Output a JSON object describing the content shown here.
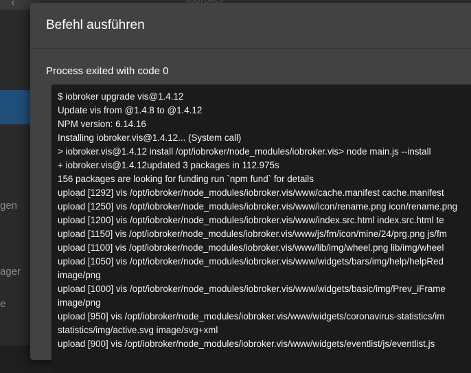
{
  "background": {
    "app_title": "iobroker",
    "sidebar_items": [
      "gen",
      "ager",
      "e"
    ]
  },
  "dialog": {
    "title": "Befehl ausführen",
    "status": "Process exited with code 0",
    "output_lines": [
      "$ iobroker upgrade vis@1.4.12",
      "Update vis from @1.4.8 to @1.4.12",
      "NPM version: 6.14.16",
      "Installing iobroker.vis@1.4.12... (System call)",
      "> iobroker.vis@1.4.12 install /opt/iobroker/node_modules/iobroker.vis> node main.js --install",
      "+ iobroker.vis@1.4.12updated 3 packages in 112.975s",
      "156 packages are looking for funding run `npm fund` for details",
      "upload [1292] vis /opt/iobroker/node_modules/iobroker.vis/www/cache.manifest cache.manifest",
      "upload [1250] vis /opt/iobroker/node_modules/iobroker.vis/www/icon/rename.png icon/rename.png",
      "upload [1200] vis /opt/iobroker/node_modules/iobroker.vis/www/index.src.html index.src.html te",
      "upload [1150] vis /opt/iobroker/node_modules/iobroker.vis/www/js/fm/icon/mine/24/prg.png js/fm",
      "upload [1100] vis /opt/iobroker/node_modules/iobroker.vis/www/lib/img/wheel.png lib/img/wheel",
      "upload [1050] vis /opt/iobroker/node_modules/iobroker.vis/www/widgets/bars/img/help/helpRed",
      "image/png",
      "upload [1000] vis /opt/iobroker/node_modules/iobroker.vis/www/widgets/basic/img/Prev_iFrame",
      "image/png",
      "upload [950] vis /opt/iobroker/node_modules/iobroker.vis/www/widgets/coronavirus-statistics/im",
      "statistics/img/active.svg image/svg+xml",
      "upload [900] vis /opt/iobroker/node_modules/iobroker.vis/www/widgets/eventlist/js/eventlist.js"
    ]
  }
}
